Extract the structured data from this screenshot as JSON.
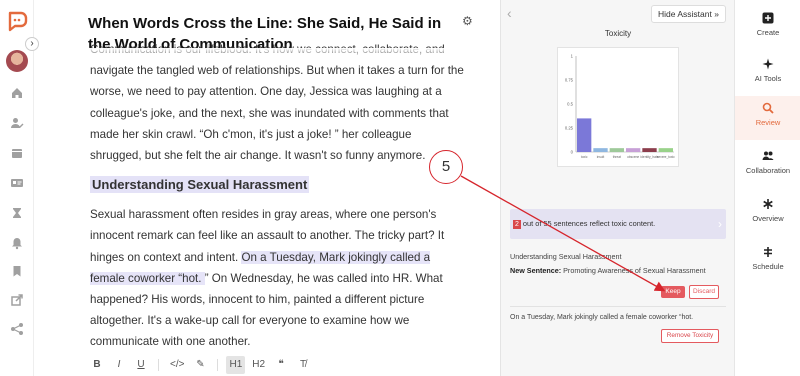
{
  "document": {
    "title": "When Words Cross the Line: She Said, He Said in the World of Communication",
    "intro_partial": "Communication is our lifeblood. It's how we connect, collaborate, and navigate the tangled web of relationships. But when it takes a turn for the worse, we need to pay attention. One day, Jessica was laughing at a colleague's joke, and the next, she was inundated with comments that made her skin crawl. “Oh c'mon, it's just a joke! ” her colleague shrugged, but she felt the air change. It wasn't so funny anymore.",
    "heading": "Understanding Sexual Harassment",
    "para2_before": "Sexual harassment often resides in gray areas, where one person's innocent remark can feel like an assault to another. The tricky part? It hinges on context and intent. ",
    "para2_highlight": "On a Tuesday, Mark jokingly called a female coworker “hot. ",
    "para2_after": "” On Wednesday, he was called into HR. What happened? His words, innocent to him, painted a different picture altogether. It's a wake-up call for everyone to examine how we communicate with one another."
  },
  "toolbar": {
    "bold": "B",
    "italic": "I",
    "underline": "U",
    "code": "</>",
    "highlight": "✎",
    "h1": "H1",
    "h2": "H2",
    "quote": "❝",
    "clear": "T̸"
  },
  "assistant": {
    "hide_label": "Hide Assistant",
    "hide_chevron": "»",
    "chart_title": "Toxicity",
    "summary_count": "2",
    "summary_text": "out of 55 sentences reflect toxic content.",
    "card1_label": "Understanding Sexual Harassment",
    "card1_new_prefix": "New Sentence:",
    "card1_new_text": "Promoting Awareness of Sexual Harassment",
    "keep_label": "Keep",
    "discard_label": "Discard",
    "card2_text": "On a Tuesday, Mark jokingly called a female coworker “hot.",
    "remove_label": "Remove Toxicity"
  },
  "chart_data": {
    "type": "bar",
    "title": "",
    "categories": [
      "toxic",
      "insult",
      "threat",
      "obscene",
      "identity_hate",
      "severe_toxic"
    ],
    "values": [
      0.35,
      0.04,
      0.04,
      0.04,
      0.04,
      0.04
    ],
    "colors": [
      "#7b78d8",
      "#8fb7e0",
      "#9ec99a",
      "#c7a0d7",
      "#8c3d4c",
      "#99d28a"
    ],
    "ylim": [
      0,
      1
    ],
    "yticks": [
      "1",
      "0.75",
      "0.5",
      "0.25",
      "0"
    ],
    "grid": false
  },
  "right_nav": {
    "items": [
      {
        "label": "Create",
        "icon": "plus-square-icon"
      },
      {
        "label": "AI Tools",
        "icon": "ai-tools-icon"
      },
      {
        "label": "Review",
        "icon": "search-icon"
      },
      {
        "label": "Collaboration",
        "icon": "users-icon"
      },
      {
        "label": "Overview",
        "icon": "asterisk-icon"
      },
      {
        "label": "Schedule",
        "icon": "schedule-icon"
      }
    ],
    "active": "Review"
  },
  "annotation": {
    "step": "5",
    "color": "#d6252c"
  },
  "colors": {
    "accent": "#e36a3d",
    "danger": "#e45a5f",
    "highlight": "#e6e4f8"
  }
}
